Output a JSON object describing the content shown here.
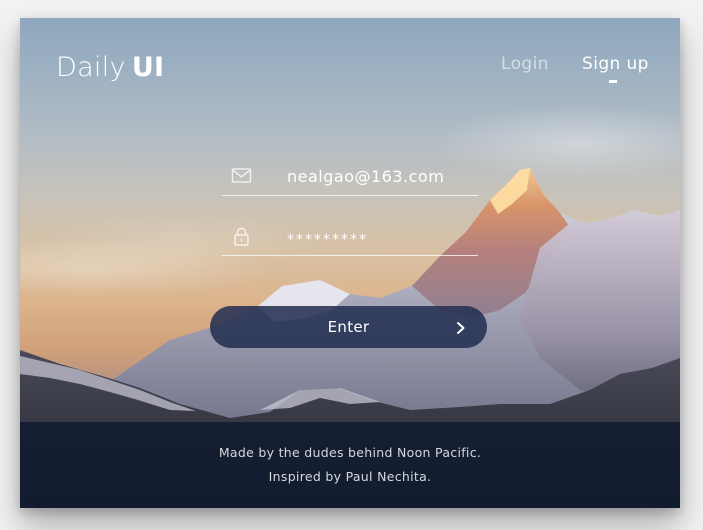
{
  "brand": {
    "part1": "Daily",
    "part2": "UI"
  },
  "nav": {
    "login_label": "Login",
    "signup_label": "Sign up",
    "active": "Sign up"
  },
  "form": {
    "email": {
      "icon": "envelope-icon",
      "value": "nealgao@163.com"
    },
    "password": {
      "icon": "lock-icon",
      "value": "*********"
    },
    "submit": {
      "label": "Enter",
      "icon": "chevron-right-icon"
    }
  },
  "footer": {
    "line1": "Made by the dudes behind Noon Pacific.",
    "line2": "Inspired by Paul Nechita."
  },
  "colors": {
    "button_bg": "#222d50",
    "footer_bg": "#101b30",
    "text": "#ffffff"
  }
}
